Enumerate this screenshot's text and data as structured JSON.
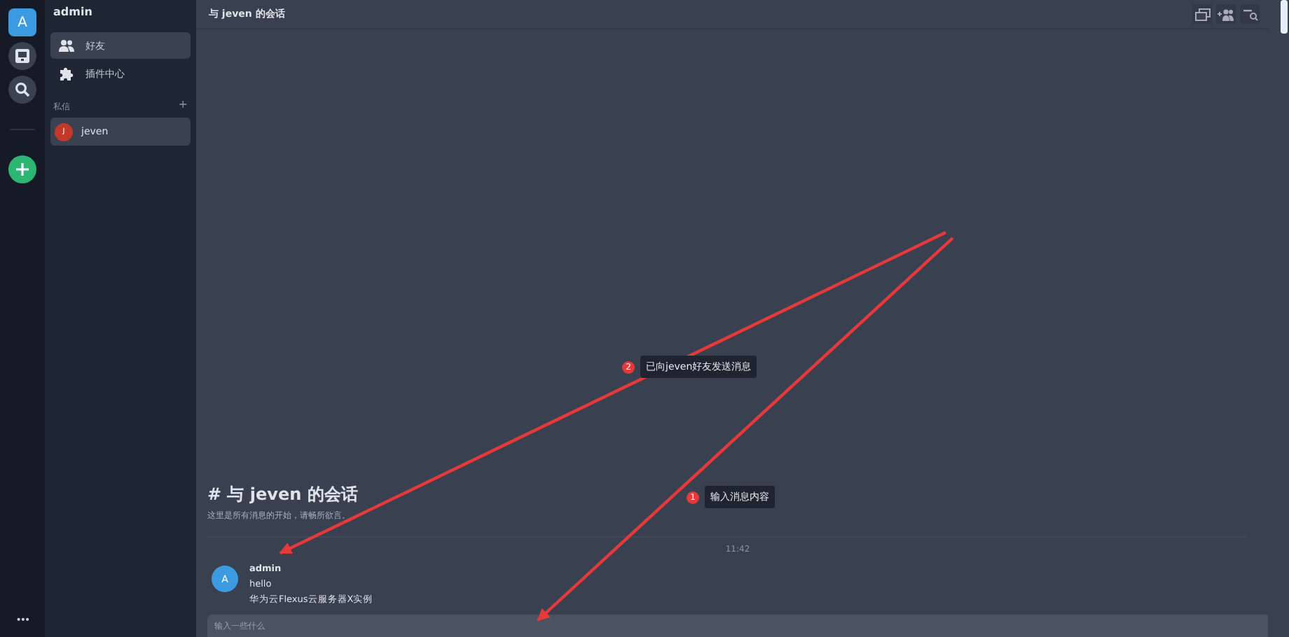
{
  "rail": {
    "avatar": "A",
    "more": "•••"
  },
  "sidebar": {
    "title": "admin",
    "nav": [
      {
        "label": "好友",
        "selected": true,
        "kind": "friends"
      },
      {
        "label": "插件中心",
        "selected": false,
        "kind": "plugin"
      }
    ],
    "section": {
      "label": "私信",
      "add": "+"
    },
    "dms": [
      {
        "initial": "J",
        "name": "jeven",
        "selected": true,
        "color": "#c0392b"
      }
    ]
  },
  "header": {
    "title": "与 jeven 的会话"
  },
  "intro": {
    "title": "# 与 jeven 的会话",
    "subtitle": "这里是所有消息的开始，请畅所欲言。"
  },
  "time": "11:42",
  "messages": [
    {
      "avatar": "A",
      "author": "admin",
      "lines": [
        "hello",
        "华为云Flexus云服务器X实例"
      ]
    }
  ],
  "composer": {
    "placeholder": "输入一些什么"
  },
  "annotations": [
    {
      "number": "2",
      "text": "已向jeven好友发送消息"
    },
    {
      "number": "1",
      "text": "输入消息内容"
    }
  ]
}
